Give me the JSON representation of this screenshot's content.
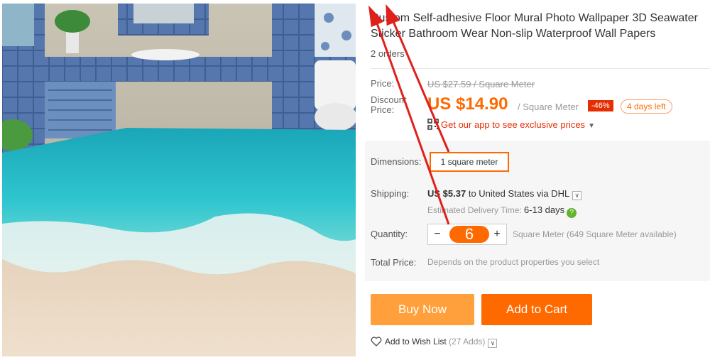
{
  "product": {
    "title": "Custom Self-adhesive Floor Mural Photo Wallpaper 3D Seawater Sticker Bathroom Wear Non-slip Waterproof Wall Papers",
    "orders": "2 orders"
  },
  "price": {
    "label": "Price:",
    "original": "US $27.59 / Square Meter",
    "discount_label": "Discount Price:",
    "current": "US $14.90",
    "unit": "/ Square Meter",
    "discount_pct": "-46%",
    "time_left": "4 days left",
    "app_promo": "Get our app to see exclusive prices"
  },
  "dimensions": {
    "label": "Dimensions:",
    "selected": "1 square meter"
  },
  "shipping": {
    "label": "Shipping:",
    "cost": "US $5.37",
    "to": "to",
    "destination": "United States via DHL",
    "delivery_label": "Estimated Delivery Time:",
    "delivery_days": "6-13 days"
  },
  "quantity": {
    "label": "Quantity:",
    "minus": "−",
    "plus": "+",
    "value": "6",
    "note": "Square Meter (649 Square Meter available)"
  },
  "total": {
    "label": "Total Price:",
    "value": "Depends on the product properties you select"
  },
  "actions": {
    "buy_now": "Buy Now",
    "add_to_cart": "Add to Cart",
    "wish_list": "Add to Wish List",
    "wish_count": "(27 Adds)"
  },
  "colors": {
    "accent": "#ff6a00",
    "buy_now": "#ffa03c",
    "discount_badge": "#e62e04",
    "annotation_arrow": "#e0201a"
  },
  "icons": [
    "qr-code-icon",
    "caret-down-icon",
    "check-circle-icon",
    "heart-icon",
    "annotation-arrow"
  ]
}
